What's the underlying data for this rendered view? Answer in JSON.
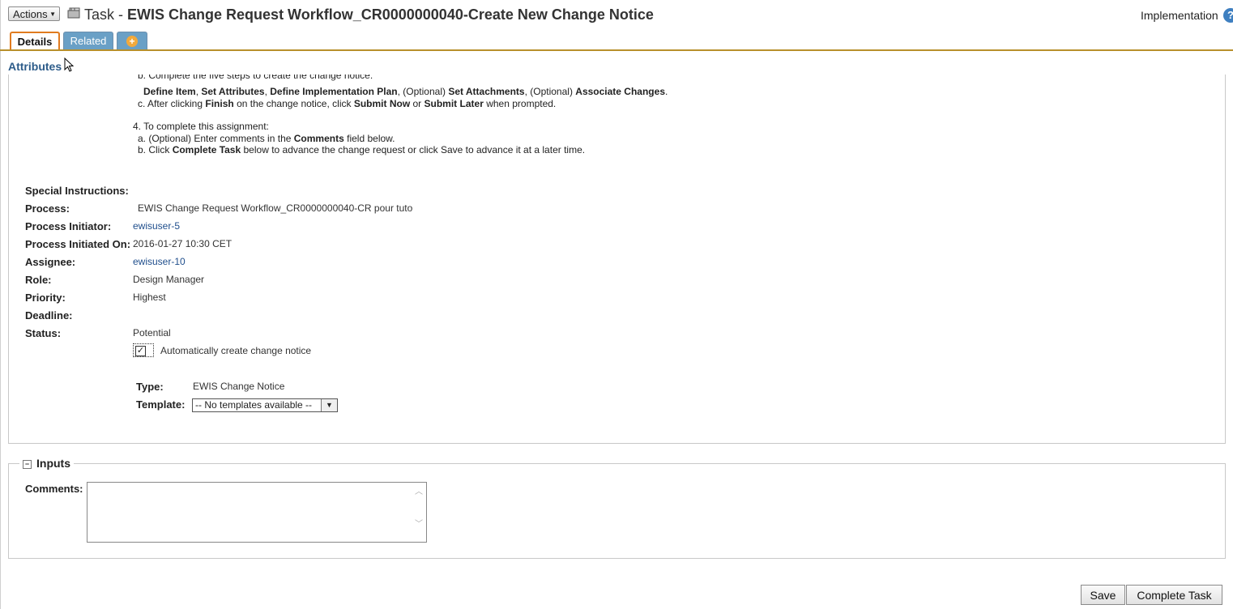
{
  "header": {
    "actions_label": "Actions",
    "title_prefix": "Task -",
    "title_main": "EWIS Change Request Workflow_CR0000000040-Create New Change Notice",
    "context": "Implementation"
  },
  "tabs": [
    {
      "label": "Details"
    },
    {
      "label": "Related"
    }
  ],
  "section_label": "Attributes",
  "instructions": {
    "line_b_cut": "b. Complete the five steps to create the change notice:",
    "line_steps": {
      "define_item": "Define Item",
      "set_attributes": "Set Attributes",
      "define_plan": "Define Implementation Plan",
      "optional1": "(Optional)",
      "set_attachments": "Set Attachments",
      "optional2": "(Optional)",
      "associate": "Associate Changes"
    },
    "line_c": {
      "pre": "c. After clicking",
      "finish": "Finish",
      "mid": "on the change notice, click",
      "submit_now": "Submit Now",
      "or": "or",
      "submit_later": "Submit Later",
      "post": "when prompted."
    },
    "line_4": "4. To complete this assignment:",
    "line_4a": {
      "pre": "a. (Optional) Enter comments in the",
      "bold": "Comments",
      "post": "field below."
    },
    "line_4b": {
      "pre": "b. Click",
      "bold": "Complete Task",
      "post": "below to advance the change request or click Save to advance it at a later time."
    }
  },
  "attributes": {
    "special_instructions_label": "Special Instructions:",
    "process_label": "Process:",
    "process_value": "EWIS Change Request Workflow_CR0000000040-CR pour tuto",
    "initiator_label": "Process Initiator:",
    "initiator_value": "ewisuser-5",
    "initiated_on_label": "Process Initiated On:",
    "initiated_on_value": "2016-01-27 10:30 CET",
    "assignee_label": "Assignee:",
    "assignee_value": "ewisuser-10",
    "role_label": "Role:",
    "role_value": "Design Manager",
    "priority_label": "Priority:",
    "priority_value": "Highest",
    "deadline_label": "Deadline:",
    "status_label": "Status:",
    "status_value": "Potential",
    "auto_create_label": "Automatically create change notice",
    "auto_create_checked": true,
    "type_label": "Type:",
    "type_value": "EWIS Change Notice",
    "template_label": "Template:",
    "template_selected": "-- No templates available --"
  },
  "inputs": {
    "title": "Inputs",
    "comments_label": "Comments:",
    "comments_value": ""
  },
  "buttons": {
    "save": "Save",
    "complete": "Complete Task"
  }
}
